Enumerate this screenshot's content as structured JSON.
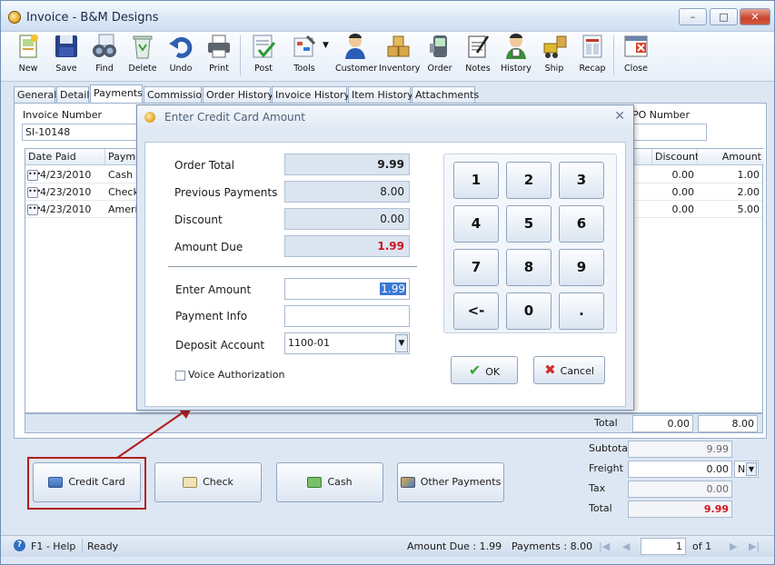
{
  "window": {
    "title": "Invoice - B&M Designs",
    "minimize": "–",
    "maximize": "□",
    "close": "✕"
  },
  "toolbar": [
    {
      "label": "New",
      "icon": "new-document-icon"
    },
    {
      "label": "Save",
      "icon": "floppy-disk-icon"
    },
    {
      "label": "Find",
      "icon": "binoculars-icon"
    },
    {
      "label": "Delete",
      "icon": "recycle-bin-icon"
    },
    {
      "label": "Undo",
      "icon": "undo-arrow-icon"
    },
    {
      "label": "Print",
      "icon": "printer-icon"
    },
    {
      "label": "Post",
      "icon": "post-checkmark-icon"
    },
    {
      "label": "Tools",
      "icon": "tools-icon"
    },
    {
      "label": "Customer",
      "icon": "customer-person-icon"
    },
    {
      "label": "Inventory",
      "icon": "inventory-boxes-icon"
    },
    {
      "label": "Order",
      "icon": "order-device-icon"
    },
    {
      "label": "Notes",
      "icon": "notepad-icon"
    },
    {
      "label": "History",
      "icon": "history-person-icon"
    },
    {
      "label": "Ship",
      "icon": "forklift-icon"
    },
    {
      "label": "Recap",
      "icon": "recap-sheet-icon"
    },
    {
      "label": "Close",
      "icon": "close-window-icon"
    }
  ],
  "tabs": [
    "General",
    "Detail",
    "Payments",
    "Commission",
    "Order History",
    "Invoice History",
    "Item History",
    "Attachments"
  ],
  "active_tab": "Payments",
  "payments": {
    "invoice_number_label": "Invoice Number",
    "invoice_number": "SI-10148",
    "po_number_label": "PO Number",
    "po_number": "",
    "columns": {
      "date_paid": "Date Paid",
      "payment": "Payment Method",
      "discount": "Discount",
      "amount": "Amount"
    },
    "rows": [
      {
        "date": "4/23/2010",
        "method": "Cash",
        "discount": "0.00",
        "amount": "1.00"
      },
      {
        "date": "4/23/2010",
        "method": "Check",
        "discount": "0.00",
        "amount": "2.00"
      },
      {
        "date": "4/23/2010",
        "method": "American Express",
        "discount": "0.00",
        "amount": "5.00"
      }
    ],
    "total_label": "Total",
    "total_discount": "0.00",
    "total_amount": "8.00"
  },
  "payment_buttons": {
    "credit_card": "Credit Card",
    "check": "Check",
    "cash": "Cash",
    "other": "Other Payments"
  },
  "summary": {
    "subtotal_label": "Subtotal",
    "subtotal": "9.99",
    "freight_label": "Freight",
    "freight": "0.00",
    "freight_code": "N",
    "tax_label": "Tax",
    "tax": "0.00",
    "total_label": "Total",
    "total": "9.99"
  },
  "status": {
    "help": "F1 - Help",
    "state": "Ready",
    "amount_due": "Amount Due : 1.99",
    "payments": "Payments : 8.00",
    "page": "1",
    "of": "of  1"
  },
  "dialog": {
    "title": "Enter Credit Card Amount",
    "close": "✕",
    "order_total_label": "Order Total",
    "order_total": "9.99",
    "previous_payments_label": "Previous Payments",
    "previous_payments": "8.00",
    "discount_label": "Discount",
    "discount": "0.00",
    "amount_due_label": "Amount Due",
    "amount_due": "1.99",
    "enter_amount_label": "Enter Amount",
    "enter_amount": "1.99",
    "payment_info_label": "Payment Info",
    "payment_info": "",
    "deposit_account_label": "Deposit Account",
    "deposit_account": "1100-01",
    "voice_auth_label": "Voice Authorization",
    "keys": [
      "1",
      "2",
      "3",
      "4",
      "5",
      "6",
      "7",
      "8",
      "9",
      "<-",
      "0",
      "."
    ],
    "ok": "OK",
    "cancel": "Cancel"
  },
  "colors": {
    "accent": "#2d5e9e",
    "amount_due": "#d0141b",
    "highlight": "#b21d1d",
    "selection": "#3a78d6"
  }
}
